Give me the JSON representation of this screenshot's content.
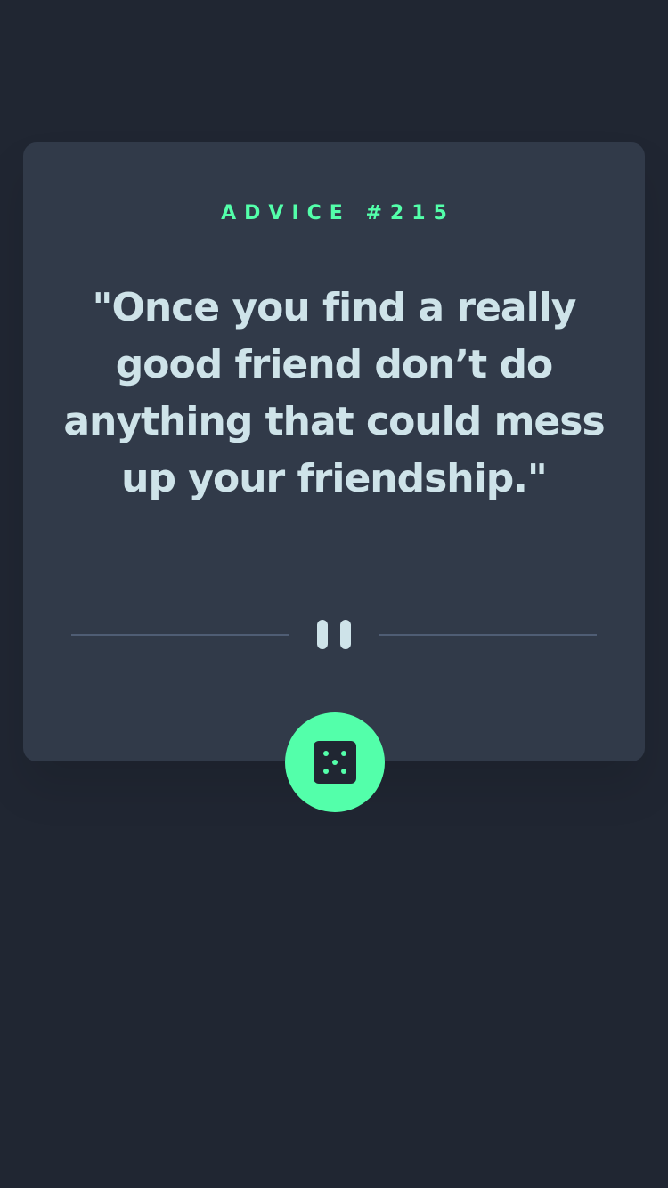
{
  "advice": {
    "id_label": "ADVICE #215",
    "quote": "\"Once you find a really good friend don’t do anything that could mess up your friendship.\""
  },
  "icons": {
    "divider": "pause-divider-icon",
    "button": "dice-icon"
  },
  "colors": {
    "background": "#202632",
    "card": "#313a49",
    "accent": "#53ffaa",
    "text": "#cee3e9",
    "divider_line": "#4f5d74"
  }
}
